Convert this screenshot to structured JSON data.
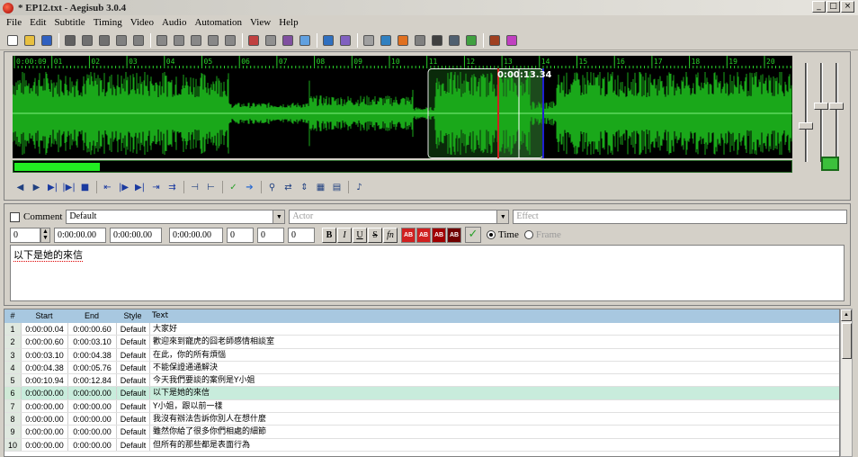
{
  "window": {
    "title": "* EP12.txt - Aegisub 3.0.4",
    "min": "_",
    "max": "□",
    "close": "×"
  },
  "menu": [
    "File",
    "Edit",
    "Subtitle",
    "Timing",
    "Video",
    "Audio",
    "Automation",
    "View",
    "Help"
  ],
  "toolbar_icons": [
    {
      "name": "new-file-icon",
      "color": "#ffffff"
    },
    {
      "name": "open-file-icon",
      "color": "#e8c040"
    },
    {
      "name": "save-file-icon",
      "color": "#3060c0"
    },
    {
      "sep": true
    },
    {
      "name": "jump-to-icon",
      "color": "#606060"
    },
    {
      "name": "zoom-in-icon",
      "color": "#707070"
    },
    {
      "name": "zoom-out-icon",
      "color": "#707070"
    },
    {
      "name": "snap-start-icon",
      "color": "#808080"
    },
    {
      "name": "snap-end-icon",
      "color": "#808080"
    },
    {
      "sep": true
    },
    {
      "name": "styles-manager-icon",
      "color": "#888888"
    },
    {
      "name": "properties-icon",
      "color": "#888888"
    },
    {
      "name": "attachments-icon",
      "color": "#888888"
    },
    {
      "name": "fonts-collector-icon",
      "color": "#888888"
    },
    {
      "name": "resample-icon",
      "color": "#888888"
    },
    {
      "sep": true
    },
    {
      "name": "automation-icon",
      "color": "#c04040"
    },
    {
      "name": "find-icon",
      "color": "#909090"
    },
    {
      "name": "replace-icon",
      "color": "#8050a0"
    },
    {
      "name": "spell-checker-icon",
      "color": "#60a0e0"
    },
    {
      "sep": true
    },
    {
      "name": "translation-assistant-icon",
      "color": "#3070c0"
    },
    {
      "name": "kanji-timer-icon",
      "color": "#8060c0"
    },
    {
      "sep": true
    },
    {
      "name": "styling-assistant-icon",
      "color": "#a0a0a0"
    },
    {
      "name": "shift-times-icon",
      "color": "#3080c0"
    },
    {
      "name": "timing-post-processor-icon",
      "color": "#e07020"
    },
    {
      "name": "visual-typesetting-icon",
      "color": "#808080"
    },
    {
      "name": "clock-icon",
      "color": "#404040"
    },
    {
      "name": "options-icon",
      "color": "#506070"
    },
    {
      "name": "checklist-icon",
      "color": "#40a040"
    },
    {
      "sep": true
    },
    {
      "name": "tools-icon",
      "color": "#a04020"
    },
    {
      "name": "keyboard-icon",
      "color": "#c040c0"
    }
  ],
  "audio": {
    "timeline_labels": [
      "0:00:09",
      "01",
      "02",
      "03",
      "04",
      "05",
      "06",
      "07",
      "08",
      "09",
      "10",
      "11",
      "12",
      "13",
      "14",
      "15",
      "16",
      "17",
      "18",
      "19",
      "20"
    ],
    "cursor_time": "0:00:13.34",
    "scroll_progress": 0.11,
    "colors": {
      "wave": "#1aa81a",
      "wave_selected": "#38e038",
      "selection_bg": "#0a2a0a",
      "start_marker": "#d02020",
      "end_marker": "#2020d0"
    },
    "controls": [
      {
        "name": "prev-line-icon",
        "glyph": "◀"
      },
      {
        "name": "next-line-icon",
        "glyph": "▶"
      },
      {
        "name": "play-selection-icon",
        "glyph": "▶|"
      },
      {
        "name": "play-line-icon",
        "glyph": "|▶|"
      },
      {
        "name": "stop-icon",
        "glyph": "■"
      },
      {
        "sep": true
      },
      {
        "name": "play-before-start-icon",
        "glyph": "⇤"
      },
      {
        "name": "play-after-start-icon",
        "glyph": "|▶"
      },
      {
        "name": "play-before-end-icon",
        "glyph": "▶|"
      },
      {
        "name": "play-after-end-icon",
        "glyph": "⇥"
      },
      {
        "name": "play-to-end-icon",
        "glyph": "⇉"
      },
      {
        "sep": true
      },
      {
        "name": "set-start-icon",
        "glyph": "⊣"
      },
      {
        "name": "set-end-icon",
        "glyph": "⊢"
      },
      {
        "sep": true
      },
      {
        "name": "commit-icon",
        "glyph": "✓"
      },
      {
        "name": "goto-icon",
        "glyph": "➔"
      },
      {
        "sep": true
      },
      {
        "name": "auto-commit-icon",
        "glyph": "⚲"
      },
      {
        "name": "auto-next-icon",
        "glyph": "⇄"
      },
      {
        "name": "auto-scroll-icon",
        "glyph": "⇕"
      },
      {
        "name": "spectrum-icon",
        "glyph": "▦"
      },
      {
        "name": "karaoke-icon",
        "glyph": "▤"
      },
      {
        "sep": true
      },
      {
        "name": "karaoke-mode-icon",
        "glyph": "♪"
      }
    ]
  },
  "edit": {
    "comment_label": "Comment",
    "style": "Default",
    "actor_placeholder": "Actor",
    "effect_placeholder": "Effect",
    "layer": "0",
    "start": "0:00:00.00",
    "end": "0:00:00.00",
    "duration": "0:00:00.00",
    "margin_l": "0",
    "margin_r": "0",
    "margin_v": "0",
    "format_buttons": [
      "B",
      "I",
      "U",
      "S",
      "fn"
    ],
    "color_buttons": [
      {
        "label": "AB",
        "color": "#d02020"
      },
      {
        "label": "AB",
        "color": "#d02020"
      },
      {
        "label": "AB",
        "color": "#a00000"
      },
      {
        "label": "AB",
        "color": "#700000"
      }
    ],
    "time_label": "Time",
    "frame_label": "Frame",
    "text": "以下是她的來信"
  },
  "grid": {
    "headers": [
      "#",
      "Start",
      "End",
      "Style",
      "Text"
    ],
    "rows": [
      {
        "n": "1",
        "start": "0:00:00.04",
        "end": "0:00:00.60",
        "style": "Default",
        "text": "大家好"
      },
      {
        "n": "2",
        "start": "0:00:00.60",
        "end": "0:00:03.10",
        "style": "Default",
        "text": "歡迎來到寵虎的囧老師感情相談室"
      },
      {
        "n": "3",
        "start": "0:00:03.10",
        "end": "0:00:04.38",
        "style": "Default",
        "text": "在此，你的所有煩惱"
      },
      {
        "n": "4",
        "start": "0:00:04.38",
        "end": "0:00:05.76",
        "style": "Default",
        "text": "不能保證通通解決"
      },
      {
        "n": "5",
        "start": "0:00:10.94",
        "end": "0:00:12.84",
        "style": "Default",
        "text": "今天我們要談的案例是Y小姐"
      },
      {
        "n": "6",
        "start": "0:00:00.00",
        "end": "0:00:00.00",
        "style": "Default",
        "text": "以下是她的來信",
        "active": true
      },
      {
        "n": "7",
        "start": "0:00:00.00",
        "end": "0:00:00.00",
        "style": "Default",
        "text": "Y小姐，跟以前一樣"
      },
      {
        "n": "8",
        "start": "0:00:00.00",
        "end": "0:00:00.00",
        "style": "Default",
        "text": "我沒有辦法告訴你別人在想什麼"
      },
      {
        "n": "9",
        "start": "0:00:00.00",
        "end": "0:00:00.00",
        "style": "Default",
        "text": "雖然你給了很多你們相處的細節"
      },
      {
        "n": "10",
        "start": "0:00:00.00",
        "end": "0:00:00.00",
        "style": "Default",
        "text": "但所有的那些都是表面行為"
      }
    ]
  }
}
